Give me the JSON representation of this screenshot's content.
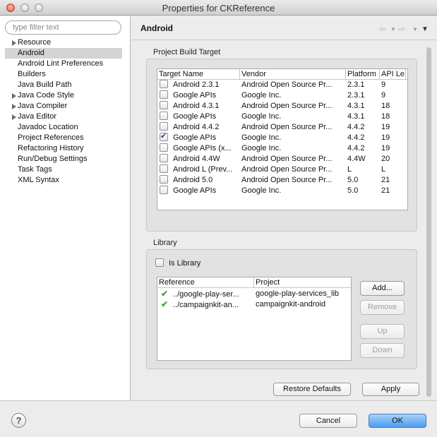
{
  "window": {
    "title": "Properties for CKReference"
  },
  "filter": {
    "placeholder": "type filter text"
  },
  "tree": [
    {
      "label": "Resource",
      "expandable": true,
      "selected": false
    },
    {
      "label": "Android",
      "expandable": false,
      "selected": true
    },
    {
      "label": "Android Lint Preferences",
      "expandable": false,
      "selected": false
    },
    {
      "label": "Builders",
      "expandable": false,
      "selected": false
    },
    {
      "label": "Java Build Path",
      "expandable": false,
      "selected": false
    },
    {
      "label": "Java Code Style",
      "expandable": true,
      "selected": false
    },
    {
      "label": "Java Compiler",
      "expandable": true,
      "selected": false
    },
    {
      "label": "Java Editor",
      "expandable": true,
      "selected": false
    },
    {
      "label": "Javadoc Location",
      "expandable": false,
      "selected": false
    },
    {
      "label": "Project References",
      "expandable": false,
      "selected": false
    },
    {
      "label": "Refactoring History",
      "expandable": false,
      "selected": false
    },
    {
      "label": "Run/Debug Settings",
      "expandable": false,
      "selected": false
    },
    {
      "label": "Task Tags",
      "expandable": false,
      "selected": false
    },
    {
      "label": "XML Syntax",
      "expandable": false,
      "selected": false
    }
  ],
  "page": {
    "title": "Android"
  },
  "nav": {
    "back": "⇦",
    "forward": "⇨",
    "dropdown": "▼",
    "menu": "▼"
  },
  "build_target": {
    "group_label": "Project Build Target",
    "columns": [
      "Target Name",
      "Vendor",
      "Platform",
      "API Le"
    ],
    "rows": [
      {
        "checked": false,
        "name": "Android 2.3.1",
        "vendor": "Android Open Source Pr...",
        "platform": "2.3.1",
        "api": "9"
      },
      {
        "checked": false,
        "name": "Google APIs",
        "vendor": "Google Inc.",
        "platform": "2.3.1",
        "api": "9"
      },
      {
        "checked": false,
        "name": "Android 4.3.1",
        "vendor": "Android Open Source Pr...",
        "platform": "4.3.1",
        "api": "18"
      },
      {
        "checked": false,
        "name": "Google APIs",
        "vendor": "Google Inc.",
        "platform": "4.3.1",
        "api": "18"
      },
      {
        "checked": false,
        "name": "Android 4.4.2",
        "vendor": "Android Open Source Pr...",
        "platform": "4.4.2",
        "api": "19"
      },
      {
        "checked": true,
        "name": "Google APIs",
        "vendor": "Google Inc.",
        "platform": "4.4.2",
        "api": "19"
      },
      {
        "checked": false,
        "name": "Google APIs (x...",
        "vendor": "Google Inc.",
        "platform": "4.4.2",
        "api": "19"
      },
      {
        "checked": false,
        "name": "Android 4.4W",
        "vendor": "Android Open Source Pr...",
        "platform": "4.4W",
        "api": "20"
      },
      {
        "checked": false,
        "name": "Android L (Prev...",
        "vendor": "Android Open Source Pr...",
        "platform": "L",
        "api": "L"
      },
      {
        "checked": false,
        "name": "Android 5.0",
        "vendor": "Android Open Source Pr...",
        "platform": "5.0",
        "api": "21"
      },
      {
        "checked": false,
        "name": "Google APIs",
        "vendor": "Google Inc.",
        "platform": "5.0",
        "api": "21"
      }
    ]
  },
  "library": {
    "group_label": "Library",
    "is_library_label": "Is Library",
    "is_library_checked": false,
    "columns": [
      "Reference",
      "Project"
    ],
    "rows": [
      {
        "reference": "../google-play-ser...",
        "project": "google-play-services_lib"
      },
      {
        "reference": "../campaignkit-an...",
        "project": "campaignkit-android"
      }
    ],
    "buttons": {
      "add": "Add...",
      "remove": "Remove",
      "up": "Up",
      "down": "Down"
    }
  },
  "actions": {
    "restore_defaults": "Restore Defaults",
    "apply": "Apply"
  },
  "footer": {
    "help": "?",
    "cancel": "Cancel",
    "ok": "OK"
  },
  "colors": {
    "selection": "#d4d4d4",
    "primary_button": "#4d9df0",
    "check_green": "#3ea63a"
  }
}
